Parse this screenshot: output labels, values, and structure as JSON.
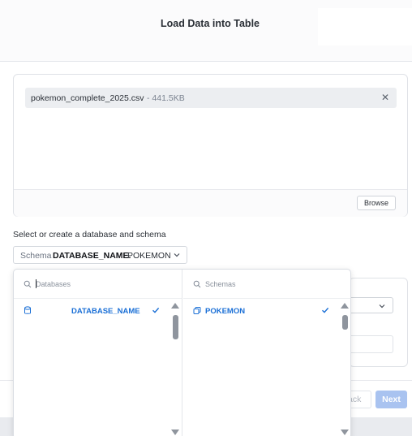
{
  "modal": {
    "title": "Load Data into Table"
  },
  "file": {
    "name": "pokemon_complete_2025.csv",
    "size": "- 441.5KB",
    "remove_icon": "close-icon"
  },
  "browse_label": "Browse",
  "database_schema": {
    "label": "Select or create a database and schema",
    "select_prefix": "Schema",
    "selected_database": "DATABASE_NAME.",
    "selected_schema": "POKEMON"
  },
  "dropdown": {
    "databases": {
      "placeholder": "Databases",
      "items": [
        {
          "label": "DATABASE_NAME",
          "selected": true,
          "icon": "database-icon"
        }
      ]
    },
    "schemas": {
      "placeholder": "Schemas",
      "items": [
        {
          "label": "POKEMON",
          "selected": true,
          "icon": "schema-icon"
        }
      ]
    }
  },
  "footer": {
    "back_label": "ack",
    "next_label": "Next"
  },
  "colors": {
    "accent": "#1a6fd6",
    "next_disabled": "#a9c3f0"
  }
}
